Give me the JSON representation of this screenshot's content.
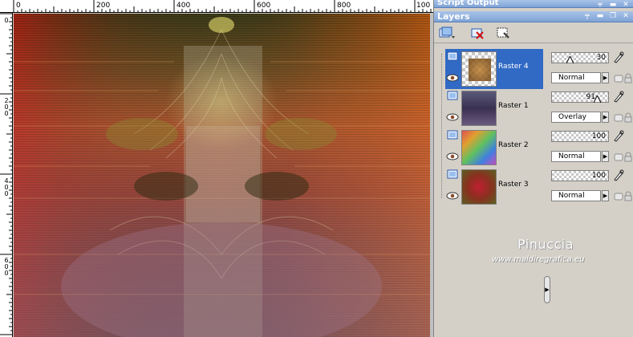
{
  "rulers": {
    "top_labels": [
      "0",
      "200",
      "400",
      "600",
      "800",
      "100"
    ],
    "left_labels": [
      "0",
      "200",
      "400",
      "600"
    ]
  },
  "panel": {
    "script_output_title": "Script Output",
    "layers_title": "Layers",
    "title_icons": [
      "pin-icon",
      "minimize-icon",
      "close-icon"
    ]
  },
  "layers": [
    {
      "name": "Raster 4",
      "opacity": "30",
      "blend": "Normal",
      "selected": true,
      "thumb": "raster4"
    },
    {
      "name": "Raster 1",
      "opacity": "91",
      "blend": "Overlay",
      "selected": false,
      "thumb": "raster1"
    },
    {
      "name": "Raster 2",
      "opacity": "100",
      "blend": "Normal",
      "selected": false,
      "thumb": "raster2"
    },
    {
      "name": "Raster 3",
      "opacity": "100",
      "blend": "Normal",
      "selected": false,
      "thumb": "raster3"
    }
  ],
  "watermark": {
    "name": "Pinuccia",
    "url": "www.maidiregrafica.eu"
  },
  "colors": {
    "selection": "#316ac5",
    "title_bar": "#7fa3d6",
    "panel_bg": "#d4d0c8"
  }
}
